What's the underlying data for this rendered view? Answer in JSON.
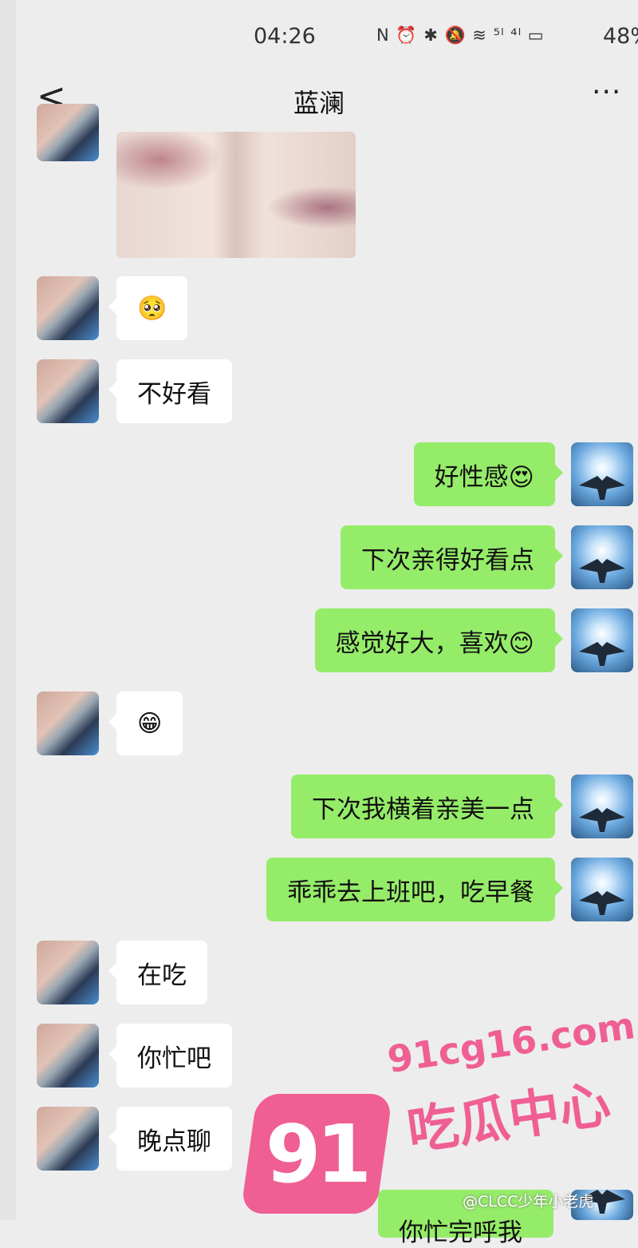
{
  "status_bar": {
    "time": "04:26",
    "icons": "N ⏰ ✱ 🔕 ≋ ⁵ˡ ⁴ˡ ▭",
    "battery": "48%"
  },
  "nav": {
    "back": "<",
    "title": "蓝澜",
    "more": "···"
  },
  "messages": [
    {
      "side": "left",
      "text": "🥺"
    },
    {
      "side": "left",
      "text": "不好看"
    },
    {
      "side": "right",
      "text": "好性感😍"
    },
    {
      "side": "right",
      "text": "下次亲得好看点"
    },
    {
      "side": "right",
      "text": "感觉好大，喜欢😊"
    },
    {
      "side": "left",
      "text": "😁"
    },
    {
      "side": "right",
      "text": "下次我横着亲美一点"
    },
    {
      "side": "right",
      "text": "乖乖去上班吧，吃早餐"
    },
    {
      "side": "left",
      "text": "在吃"
    },
    {
      "side": "left",
      "text": "你忙吧"
    },
    {
      "side": "left",
      "text": "晚点聊"
    },
    {
      "side": "right",
      "text": "你忙完呼我"
    }
  ],
  "watermark": {
    "number": "91",
    "domain": "91cg16.com",
    "name": "吃瓜中心",
    "weibo": "@CLCC少年小老虎"
  },
  "colors": {
    "background": "#ededed",
    "self_bubble": "#95ec69",
    "other_bubble": "#ffffff",
    "watermark": "#ef5f93"
  }
}
